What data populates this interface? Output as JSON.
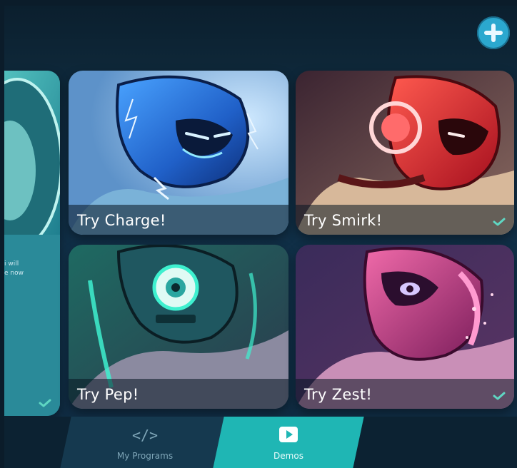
{
  "header": {
    "add_icon": "plus-icon"
  },
  "cards": [
    {
      "label": "Try Charge!",
      "checked": false,
      "accent": "#2b6fd8"
    },
    {
      "label": "Try Smirk!",
      "checked": true,
      "accent": "#d8333a"
    },
    {
      "label": "Try Pep!",
      "checked": false,
      "accent": "#27c4a8"
    },
    {
      "label": "Try Zest!",
      "checked": true,
      "accent": "#c2387f"
    }
  ],
  "partial_card": {
    "line1": "i will",
    "line2": "e now",
    "checked": true
  },
  "nav": {
    "programs_label": "My Programs",
    "demos_label": "Demos",
    "programs_icon": "</>",
    "active_tab": "Demos"
  },
  "colors": {
    "background": "#11314a",
    "add_button": "#2ba8cf",
    "active_tab": "#1fb6b4",
    "check": "#5fd6c2"
  }
}
